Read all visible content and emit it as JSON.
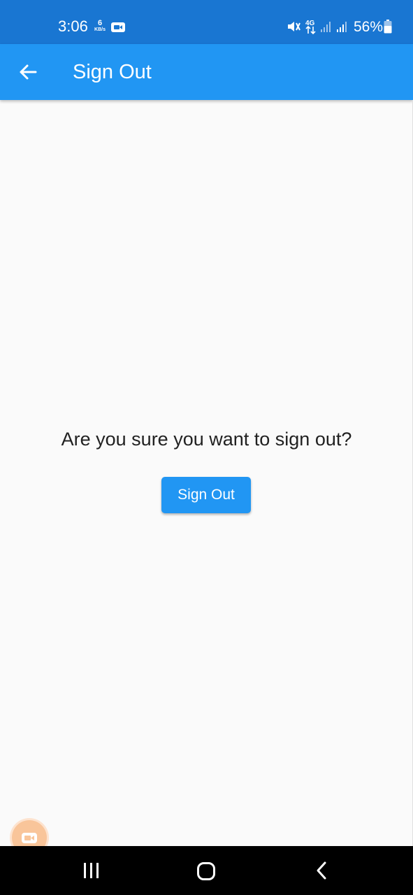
{
  "status_bar": {
    "time": "3:06",
    "net_speed_value": "6",
    "net_speed_unit": "KB/s",
    "network_label": "4G",
    "battery_percent": "56%",
    "icons": [
      "video-camera-icon",
      "mute-icon",
      "4g-data-icon",
      "signal-icon",
      "signal-icon",
      "battery-icon"
    ]
  },
  "app_bar": {
    "title": "Sign Out",
    "back_icon": "arrow-back-icon",
    "color": "#2196f3"
  },
  "main": {
    "question": "Are you sure you want to sign out?",
    "sign_out_button_label": "Sign Out"
  },
  "floating": {
    "recorder_icon": "video-camera-icon"
  },
  "nav_bar": {
    "icons": [
      "recents-icon",
      "home-icon",
      "back-icon"
    ]
  },
  "colors": {
    "status_bar": "#1976d2",
    "app_bar": "#2196f3",
    "background": "#fafafa",
    "text": "#212121",
    "recorder": "#f9c59a"
  }
}
